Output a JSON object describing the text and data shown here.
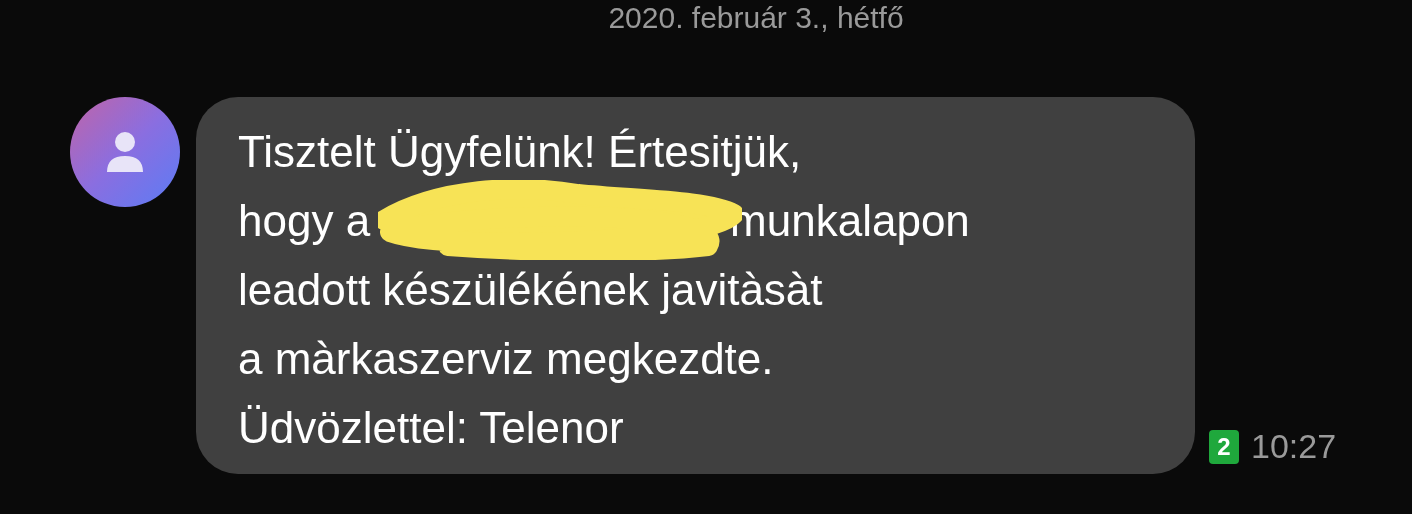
{
  "date_header": "2020. február 3., hétfő",
  "message": {
    "lines": [
      {
        "kind": "plain",
        "text": "Tisztelt Ügyfelünk! Értesitjük,"
      },
      {
        "kind": "redacted",
        "before": "hogy a",
        "after": "munkalapon"
      },
      {
        "kind": "plain",
        "text": "leadott készülékének javitàsàt"
      },
      {
        "kind": "plain",
        "text": "a màrkaszerviz megkezdte."
      },
      {
        "kind": "plain",
        "text": "Üdvözlettel: Telenor"
      }
    ],
    "sim": "2",
    "time": "10:27"
  }
}
